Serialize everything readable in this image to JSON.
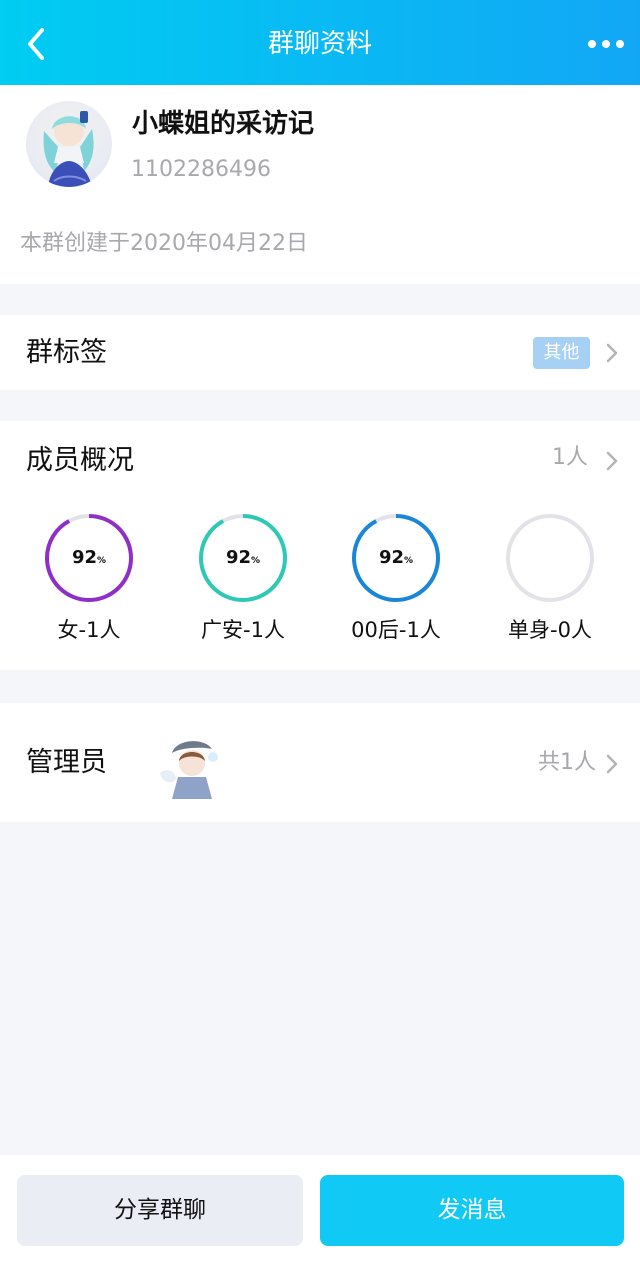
{
  "header": {
    "title": "群聊资料"
  },
  "profile": {
    "name": "小蝶姐的采访记",
    "id": "1102286496",
    "created": "本群创建于2020年04月22日"
  },
  "tags": {
    "title": "群标签",
    "badge": "其他"
  },
  "members": {
    "title": "成员概况",
    "count": "1人",
    "stats": [
      {
        "value": "92",
        "unit": "%",
        "label": "女-1人",
        "color": "#8f2fc9",
        "fraction": 0.92
      },
      {
        "value": "92",
        "unit": "%",
        "label": "广安-1人",
        "color": "#2ec9b4",
        "fraction": 0.92
      },
      {
        "value": "92",
        "unit": "%",
        "label": "00后-1人",
        "color": "#1a86d8",
        "fraction": 0.92
      },
      {
        "value": "",
        "unit": "",
        "label": "单身-0人",
        "color": "#e2e2e8",
        "fraction": 0
      }
    ]
  },
  "admins": {
    "title": "管理员",
    "count": "共1人"
  },
  "actions": {
    "share": "分享群聊",
    "send": "发消息"
  },
  "colors": {
    "header_start": "#00cdf2",
    "header_end": "#12a7f5",
    "send_button": "#10c9f5",
    "tag_badge": "#a7d0f5",
    "ring_track": "#e2e2e8"
  }
}
